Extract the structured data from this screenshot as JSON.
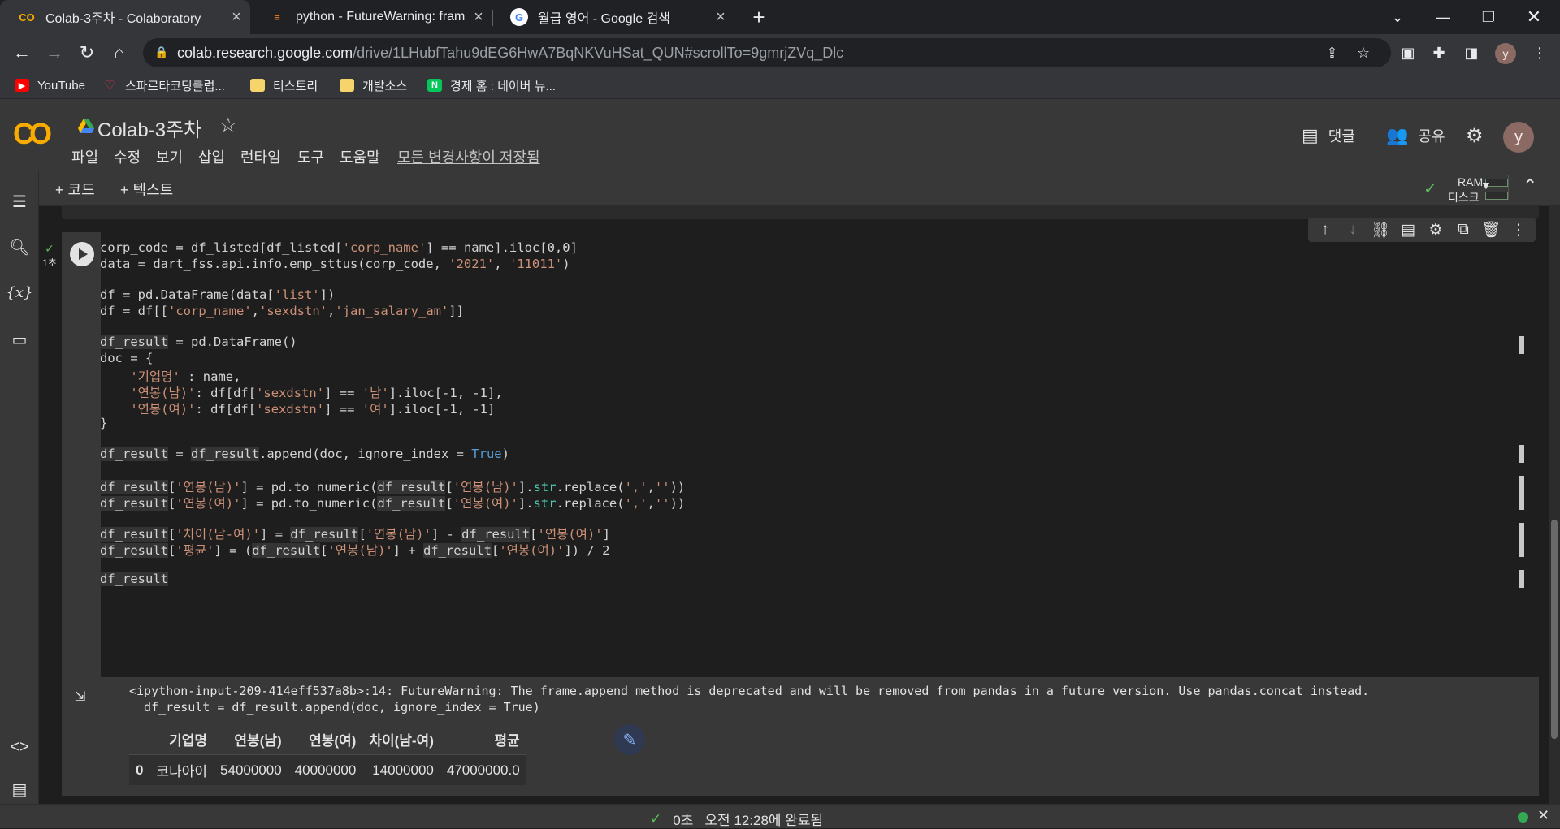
{
  "browser": {
    "tabs": [
      {
        "title": "Colab-3주차 - Colaboratory",
        "icon": "colab-favicon",
        "active": true
      },
      {
        "title": "python - FutureWarning: frame.a",
        "icon": "stackoverflow-favicon",
        "active": false
      },
      {
        "title": "월급 영어 - Google 검색",
        "icon": "google-favicon",
        "active": false
      }
    ],
    "new_tab": "+",
    "url_domain": "colab.research.google.com",
    "url_path": "/drive/1LHubfTahu9dEG6HwA7BqNKVuHSat_QUN#scrollTo=9gmrjZVq_Dlc",
    "profile_initial": "y",
    "bookmarks": [
      {
        "label": "YouTube",
        "icon": "youtube-icon"
      },
      {
        "label": "스파르타코딩클럽...",
        "icon": "sparta-icon"
      },
      {
        "label": "티스토리",
        "icon": "folder-icon"
      },
      {
        "label": "개발소스",
        "icon": "folder-icon"
      },
      {
        "label": "경제 홈 : 네이버 뉴...",
        "icon": "naver-icon"
      }
    ]
  },
  "colab": {
    "title": "Colab-3주차",
    "menu": [
      "파일",
      "수정",
      "보기",
      "삽입",
      "런타임",
      "도구",
      "도움말"
    ],
    "saved_status": "모든 변경사항이 저장됨",
    "comment_label": "댓글",
    "share_label": "공유",
    "user_initial": "y",
    "add_code": "+ 코드",
    "add_text": "+ 텍스트",
    "ram_label": "RAM",
    "disk_label": "디스크"
  },
  "cell": {
    "exec_time": "1초",
    "warning_line1": "<ipython-input-209-414eff537a8b>:14: FutureWarning: The frame.append method is deprecated and will be removed from pandas in a future version. Use pandas.concat instead.",
    "warning_line2": "  df_result = df_result.append(doc, ignore_index = True)",
    "table": {
      "columns": [
        "",
        "기업명",
        "연봉(남)",
        "연봉(여)",
        "차이(남-여)",
        "평균"
      ],
      "rows": [
        [
          "0",
          "코나아이",
          "54000000",
          "40000000",
          "14000000",
          "47000000.0"
        ]
      ]
    }
  },
  "status_bar": {
    "duration": "0초",
    "completed": "오전 12:28에 완료됨"
  }
}
